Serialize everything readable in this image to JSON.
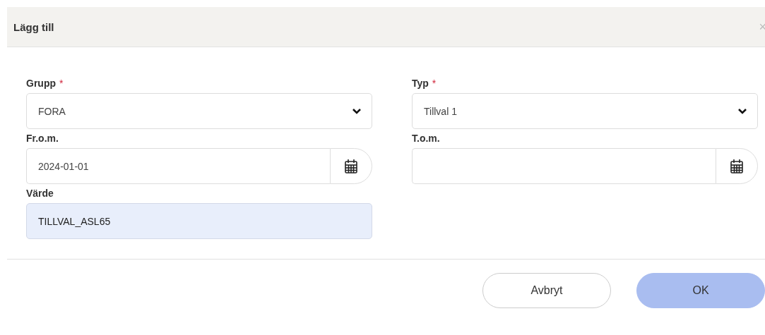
{
  "dialog": {
    "title": "Lägg till",
    "close": "×"
  },
  "fields": [
    {
      "label": "Grupp",
      "required_mark": "*",
      "kind": "select",
      "value": "FORA"
    },
    {
      "label": "Typ",
      "required_mark": "*",
      "kind": "select",
      "value": "Tillval 1"
    },
    {
      "label": "Fr.o.m.",
      "kind": "date",
      "value": "2024-01-01"
    },
    {
      "label": "T.o.m.",
      "kind": "date"
    },
    {
      "label": "Värde",
      "kind": "text",
      "value": "TILLVAL_ASL65"
    }
  ],
  "buttons": [
    {
      "label": "Avbryt",
      "kind": "secondary"
    },
    {
      "label": "OK",
      "kind": "primary"
    }
  ]
}
